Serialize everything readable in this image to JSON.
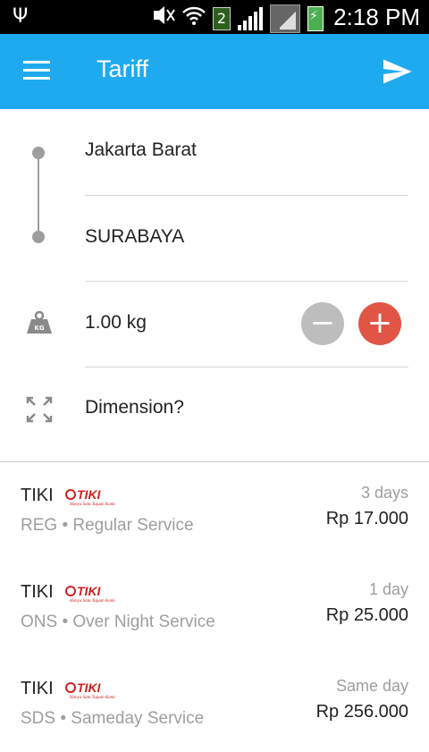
{
  "status_bar": {
    "time": "2:18 PM",
    "sim_number": "2",
    "icons": [
      "usb-icon",
      "no-sound-icon",
      "wifi-icon",
      "signal-icon",
      "battery-charging-icon"
    ]
  },
  "app_bar": {
    "title": "Tariff",
    "menu_icon": "hamburger-menu-icon",
    "action_icon": "send-icon",
    "color": "#1faaf0"
  },
  "form": {
    "origin": "Jakarta Barat",
    "destination": "SURABAYA",
    "weight": "1.00 kg",
    "weight_icon_label": "KG",
    "dimension_label": "Dimension?",
    "minus_color": "#bdbdbd",
    "plus_color": "#e05546"
  },
  "results": [
    {
      "courier": "TIKI",
      "logo_text": "TIKI",
      "logo_tagline": "Hanya Satu Tujuan Kami",
      "code": "REG",
      "service": "Regular Service",
      "service_line": "REG  • Regular Service",
      "duration": "3 days",
      "price": "Rp 17.000"
    },
    {
      "courier": "TIKI",
      "logo_text": "TIKI",
      "logo_tagline": "Hanya Satu Tujuan Kami",
      "code": "ONS",
      "service": "Over Night Service",
      "service_line": "ONS  • Over Night Service",
      "duration": "1 day",
      "price": "Rp 25.000"
    },
    {
      "courier": "TIKI",
      "logo_text": "TIKI",
      "logo_tagline": "Hanya Satu Tujuan Kami",
      "code": "SDS",
      "service": "Sameday Service",
      "service_line": "SDS  • Sameday Service",
      "duration": "Same day",
      "price": "Rp 256.000"
    }
  ]
}
